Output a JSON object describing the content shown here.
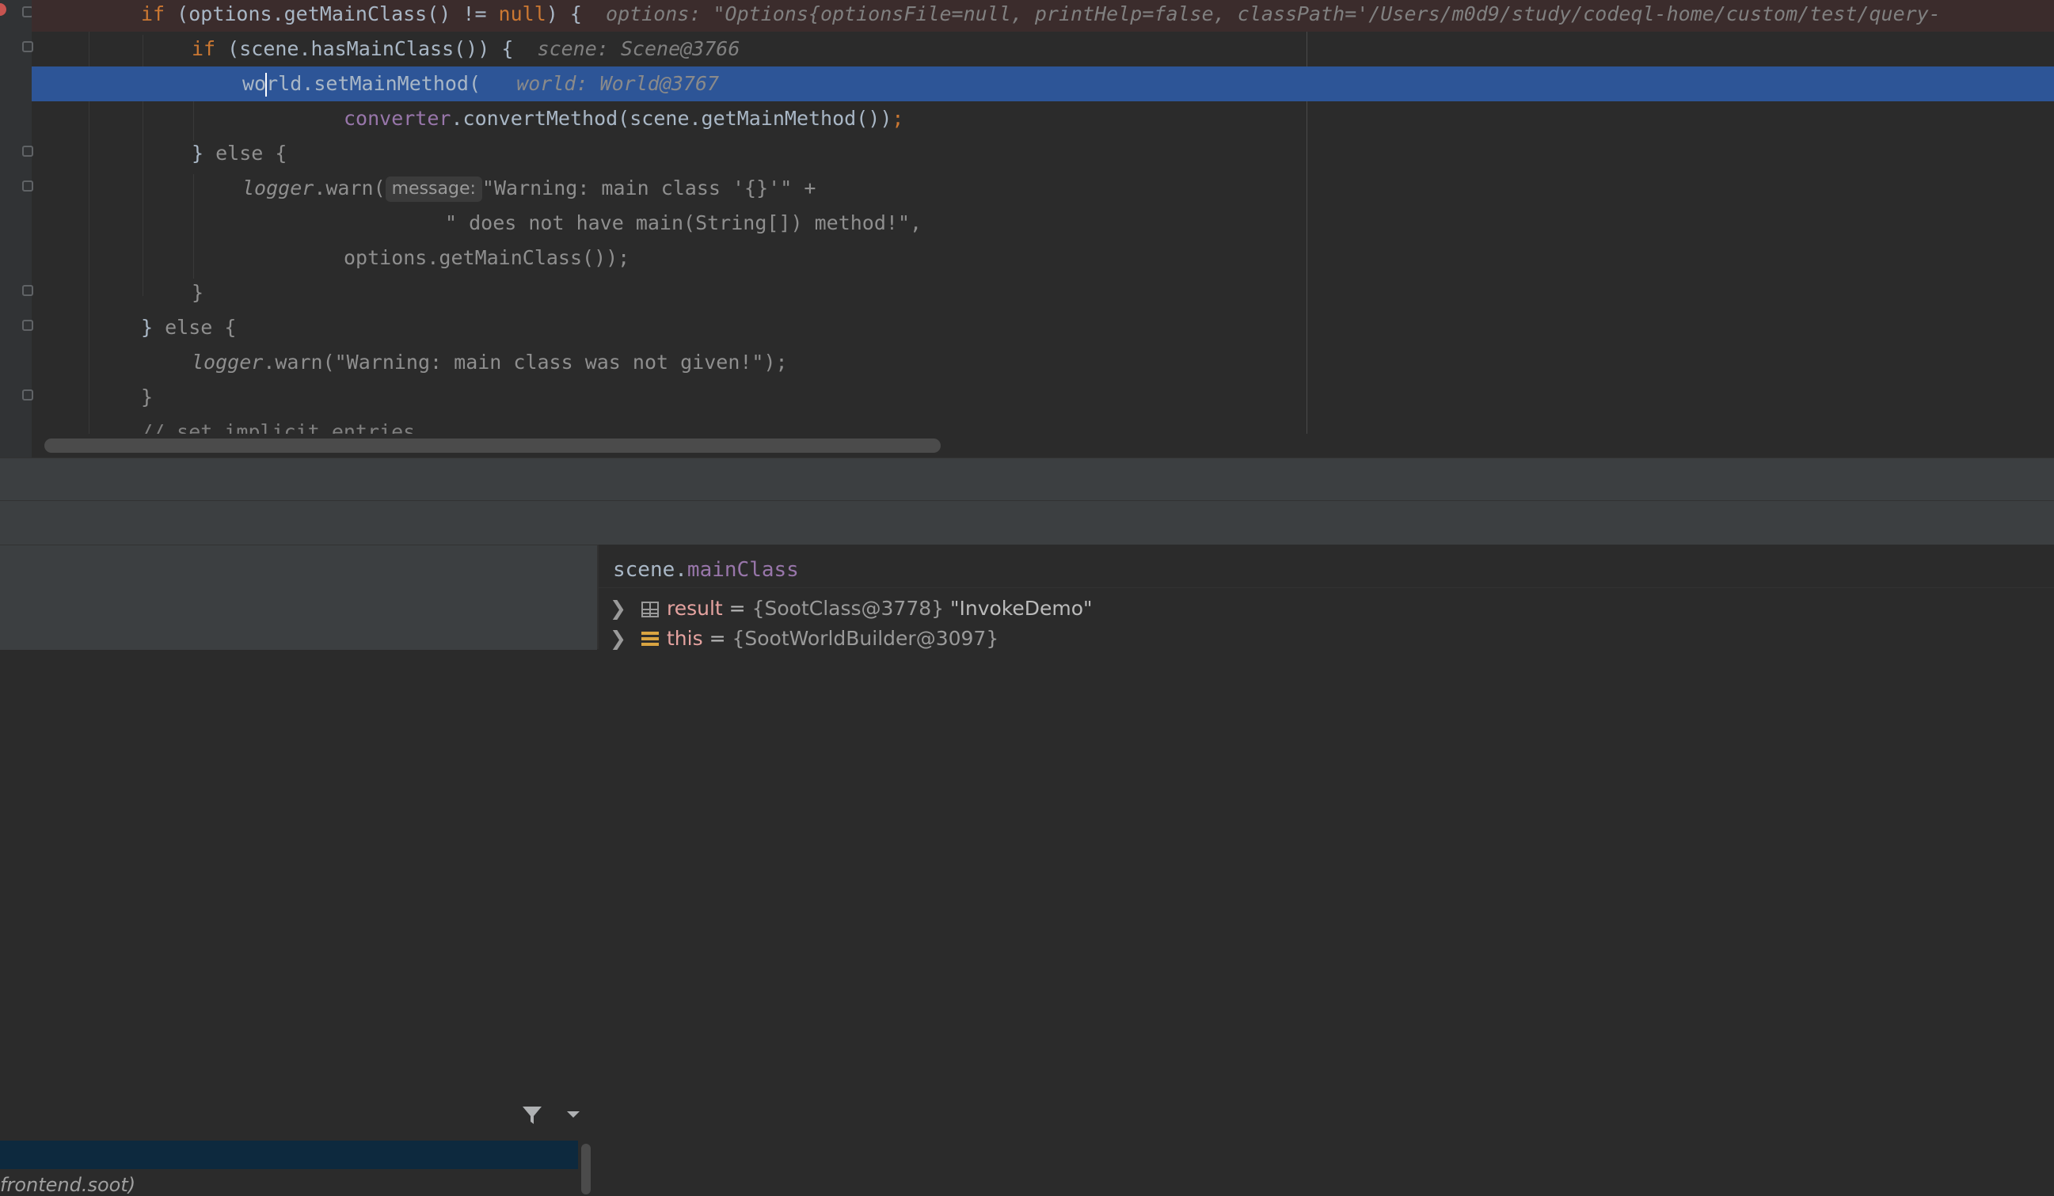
{
  "editor": {
    "lines": {
      "l1": {
        "kw_if": "if",
        "code": " (options.getMainClass() != ",
        "kw_null": "null",
        "end": ") {",
        "hint": "options: \"Options{optionsFile=null, printHelp=false, classPath='/Users/m0d9/study/codeql-home/custom/test/query-"
      },
      "l2": {
        "kw_if": "if",
        "code": " (scene.hasMainClass()) {",
        "hint": "scene: Scene@3766"
      },
      "l3": {
        "pre": "wo",
        "post": "rld.setMainMethod(",
        "hint": "world: World@3767"
      },
      "l4": {
        "field": "converter",
        "code": ".convertMethod(scene.getMainMethod())",
        "semi": ";"
      },
      "l5": {
        "close": "} ",
        "kw_else": "else",
        "open": " {"
      },
      "l6": {
        "logger": "logger",
        "code": ".warn(",
        "param": "message:",
        "str": "\"Warning: main class '{}'\"",
        "plus": " +"
      },
      "l7": {
        "str": "\" does not have main(String[]) method!\"",
        "comma": ","
      },
      "l8": {
        "code": "options.getMainClass());"
      },
      "l9": {
        "close": "}"
      },
      "l10": {
        "close": "} ",
        "kw_else": "else",
        "open": " {"
      },
      "l11": {
        "logger": "logger",
        "code": ".warn(",
        "str": "\"Warning: main class was not given!\"",
        "end": ");"
      },
      "l12": {
        "close": "}"
      },
      "l13": {
        "comment": "// set implicit entries"
      }
    }
  },
  "debugger": {
    "frames": {
      "partial_frame": "frontend.soot)"
    },
    "evaluate": {
      "obj": "scene.",
      "member": "mainClass"
    },
    "variables": [
      {
        "name": "result",
        "eq": " = ",
        "type": "{SootClass@3778}",
        "value": " \"InvokeDemo\""
      },
      {
        "name": "this",
        "eq": " = ",
        "type": "{SootWorldBuilder@3097}",
        "value": ""
      }
    ]
  },
  "icons": [
    "fold-icon",
    "breakpoint-icon",
    "filter-icon",
    "dropdown-icon",
    "expand-arrow-icon",
    "table-icon",
    "field-icon"
  ],
  "colors": {
    "keyword": "#cc7832",
    "field": "#9876aa",
    "string": "#6a8759",
    "selection": "#2d5597",
    "variable_name": "#e5a3a0"
  }
}
